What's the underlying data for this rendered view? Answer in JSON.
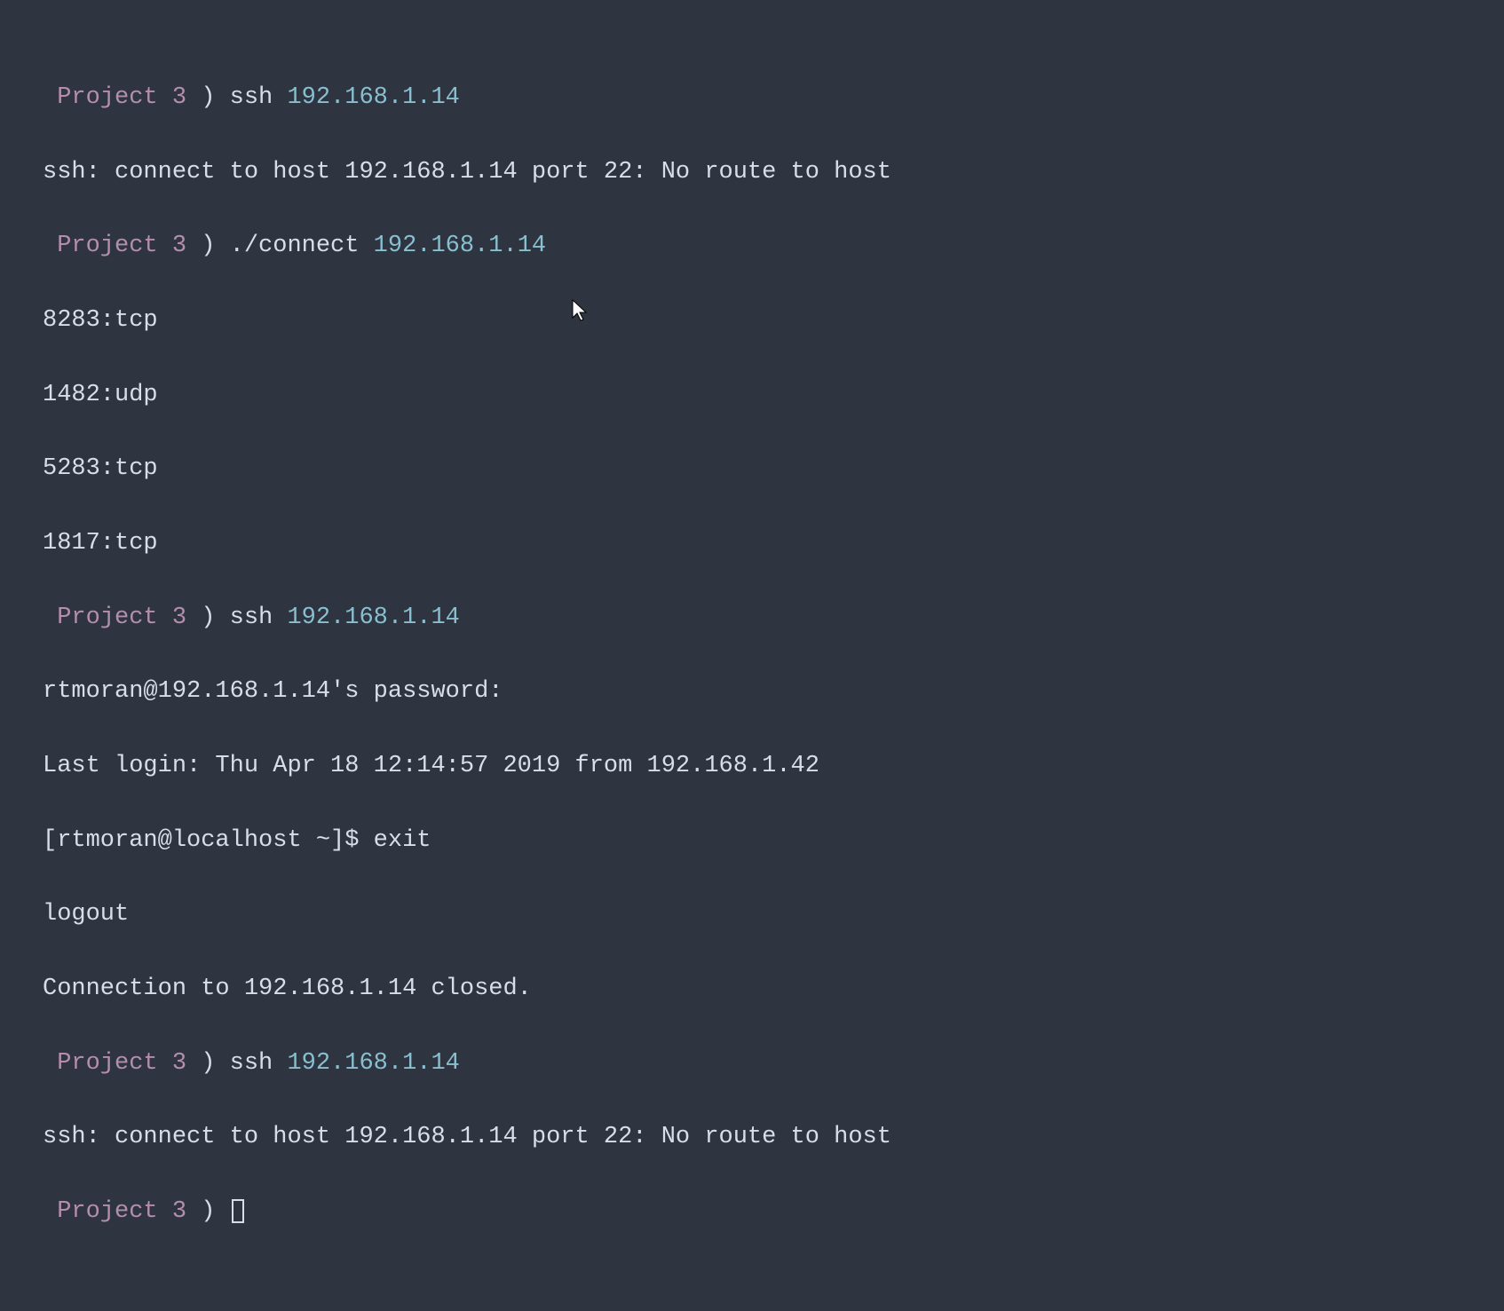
{
  "prompt": {
    "dir": "Project 3",
    "paren": ")"
  },
  "lines": [
    {
      "type": "prompt",
      "cmd": "ssh",
      "arg": "192.168.1.14"
    },
    {
      "type": "output",
      "text": "ssh: connect to host 192.168.1.14 port 22: No route to host"
    },
    {
      "type": "prompt",
      "cmd": "./connect",
      "arg": "192.168.1.14"
    },
    {
      "type": "output",
      "text": "8283:tcp"
    },
    {
      "type": "output",
      "text": "1482:udp"
    },
    {
      "type": "output",
      "text": "5283:tcp"
    },
    {
      "type": "output",
      "text": "1817:tcp"
    },
    {
      "type": "prompt",
      "cmd": "ssh",
      "arg": "192.168.1.14"
    },
    {
      "type": "output",
      "text": "rtmoran@192.168.1.14's password: "
    },
    {
      "type": "output",
      "text": "Last login: Thu Apr 18 12:14:57 2019 from 192.168.1.42"
    },
    {
      "type": "output",
      "text": "[rtmoran@localhost ~]$ exit"
    },
    {
      "type": "output",
      "text": "logout"
    },
    {
      "type": "output",
      "text": "Connection to 192.168.1.14 closed."
    },
    {
      "type": "prompt",
      "cmd": "ssh",
      "arg": "192.168.1.14"
    },
    {
      "type": "output",
      "text": "ssh: connect to host 192.168.1.14 port 22: No route to host"
    },
    {
      "type": "prompt-empty"
    }
  ]
}
